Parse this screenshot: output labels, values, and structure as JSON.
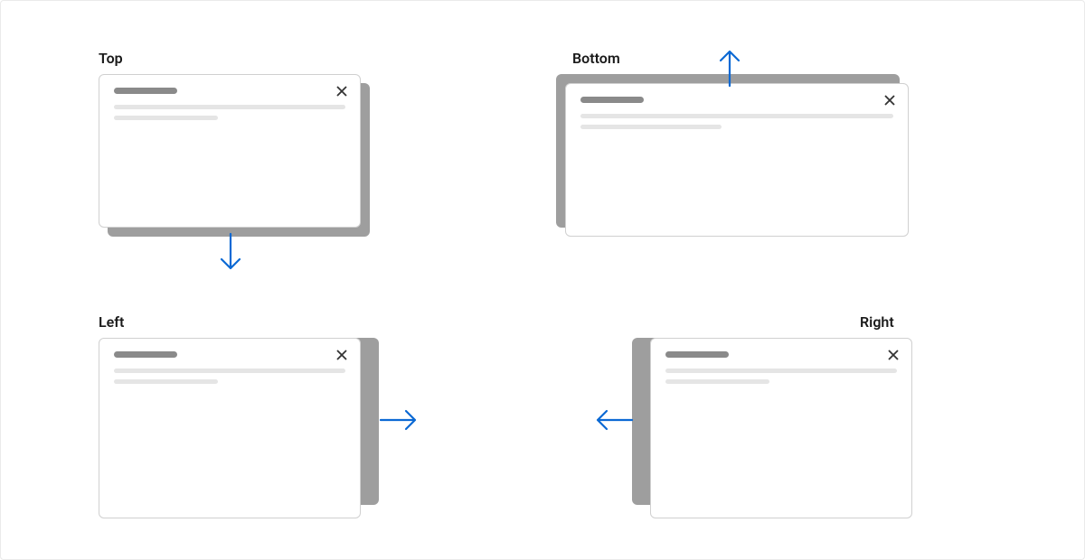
{
  "examples": {
    "top": {
      "label": "Top"
    },
    "bottom": {
      "label": "Bottom"
    },
    "left": {
      "label": "Left"
    },
    "right": {
      "label": "Right"
    }
  },
  "colors": {
    "arrow": "#0b69d4",
    "shadow": "#9e9e9e",
    "border": "#d0d0d0"
  }
}
